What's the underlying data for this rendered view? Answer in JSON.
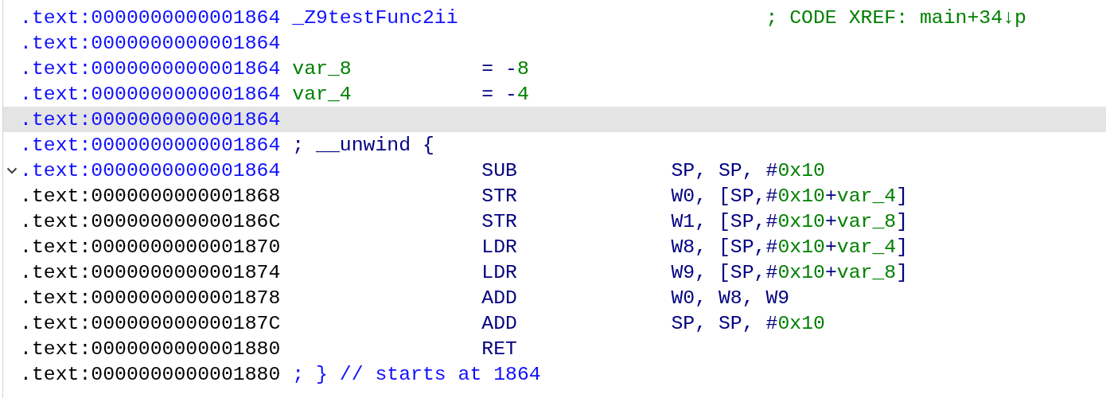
{
  "listing": {
    "rows": [
      {
        "address": ".text:0000000000001864",
        "kind": "function",
        "highlighted": false,
        "collapsible": false,
        "label": [
          {
            "text": "_Z9testFunc2ii",
            "kind": "name"
          }
        ],
        "comment": [
          {
            "text": "; CODE XREF: main+34↓p",
            "kind": "xref"
          }
        ]
      },
      {
        "address": ".text:0000000000001864",
        "kind": "function",
        "highlighted": false,
        "collapsible": false
      },
      {
        "address": ".text:0000000000001864",
        "kind": "function",
        "highlighted": false,
        "collapsible": false,
        "label": [
          {
            "text": "var_8",
            "kind": "local"
          }
        ],
        "mnemonic": [
          {
            "text": "= -",
            "kind": "code"
          },
          {
            "text": "8",
            "kind": "number"
          }
        ]
      },
      {
        "address": ".text:0000000000001864",
        "kind": "function",
        "highlighted": false,
        "collapsible": false,
        "label": [
          {
            "text": "var_4",
            "kind": "local"
          }
        ],
        "mnemonic": [
          {
            "text": "= -",
            "kind": "code"
          },
          {
            "text": "4",
            "kind": "number"
          }
        ]
      },
      {
        "address": ".text:0000000000001864",
        "kind": "function",
        "highlighted": true,
        "collapsible": false
      },
      {
        "address": ".text:0000000000001864",
        "kind": "function",
        "highlighted": false,
        "collapsible": false,
        "label": [
          {
            "text": "; __unwind {",
            "kind": "code"
          }
        ]
      },
      {
        "address": ".text:0000000000001864",
        "kind": "function",
        "highlighted": false,
        "collapsible": true,
        "mnemonic": [
          {
            "text": "SUB",
            "kind": "code"
          }
        ],
        "operands": [
          {
            "text": "SP, SP, #",
            "kind": "code"
          },
          {
            "text": "0x10",
            "kind": "number"
          }
        ]
      },
      {
        "address": ".text:0000000000001868",
        "kind": "code",
        "highlighted": false,
        "collapsible": false,
        "mnemonic": [
          {
            "text": "STR",
            "kind": "code"
          }
        ],
        "operands": [
          {
            "text": "W0, [SP,#",
            "kind": "code"
          },
          {
            "text": "0x10",
            "kind": "number"
          },
          {
            "text": "+",
            "kind": "code"
          },
          {
            "text": "var_4",
            "kind": "local"
          },
          {
            "text": "]",
            "kind": "code"
          }
        ]
      },
      {
        "address": ".text:000000000000186C",
        "kind": "code",
        "highlighted": false,
        "collapsible": false,
        "mnemonic": [
          {
            "text": "STR",
            "kind": "code"
          }
        ],
        "operands": [
          {
            "text": "W1, [SP,#",
            "kind": "code"
          },
          {
            "text": "0x10",
            "kind": "number"
          },
          {
            "text": "+",
            "kind": "code"
          },
          {
            "text": "var_8",
            "kind": "local"
          },
          {
            "text": "]",
            "kind": "code"
          }
        ]
      },
      {
        "address": ".text:0000000000001870",
        "kind": "code",
        "highlighted": false,
        "collapsible": false,
        "mnemonic": [
          {
            "text": "LDR",
            "kind": "code"
          }
        ],
        "operands": [
          {
            "text": "W8, [SP,#",
            "kind": "code"
          },
          {
            "text": "0x10",
            "kind": "number"
          },
          {
            "text": "+",
            "kind": "code"
          },
          {
            "text": "var_4",
            "kind": "local"
          },
          {
            "text": "]",
            "kind": "code"
          }
        ]
      },
      {
        "address": ".text:0000000000001874",
        "kind": "code",
        "highlighted": false,
        "collapsible": false,
        "mnemonic": [
          {
            "text": "LDR",
            "kind": "code"
          }
        ],
        "operands": [
          {
            "text": "W9, [SP,#",
            "kind": "code"
          },
          {
            "text": "0x10",
            "kind": "number"
          },
          {
            "text": "+",
            "kind": "code"
          },
          {
            "text": "var_8",
            "kind": "local"
          },
          {
            "text": "]",
            "kind": "code"
          }
        ]
      },
      {
        "address": ".text:0000000000001878",
        "kind": "code",
        "highlighted": false,
        "collapsible": false,
        "mnemonic": [
          {
            "text": "ADD",
            "kind": "code"
          }
        ],
        "operands": [
          {
            "text": "W0, W8, W9",
            "kind": "code"
          }
        ]
      },
      {
        "address": ".text:000000000000187C",
        "kind": "code",
        "highlighted": false,
        "collapsible": false,
        "mnemonic": [
          {
            "text": "ADD",
            "kind": "code"
          }
        ],
        "operands": [
          {
            "text": "SP, SP, #",
            "kind": "code"
          },
          {
            "text": "0x10",
            "kind": "number"
          }
        ]
      },
      {
        "address": ".text:0000000000001880",
        "kind": "code",
        "highlighted": false,
        "collapsible": false,
        "mnemonic": [
          {
            "text": "RET",
            "kind": "code"
          }
        ]
      },
      {
        "address": ".text:0000000000001880",
        "kind": "code",
        "highlighted": false,
        "collapsible": false,
        "label": [
          {
            "text": "; } // starts at 1864",
            "kind": "name"
          }
        ]
      }
    ]
  }
}
